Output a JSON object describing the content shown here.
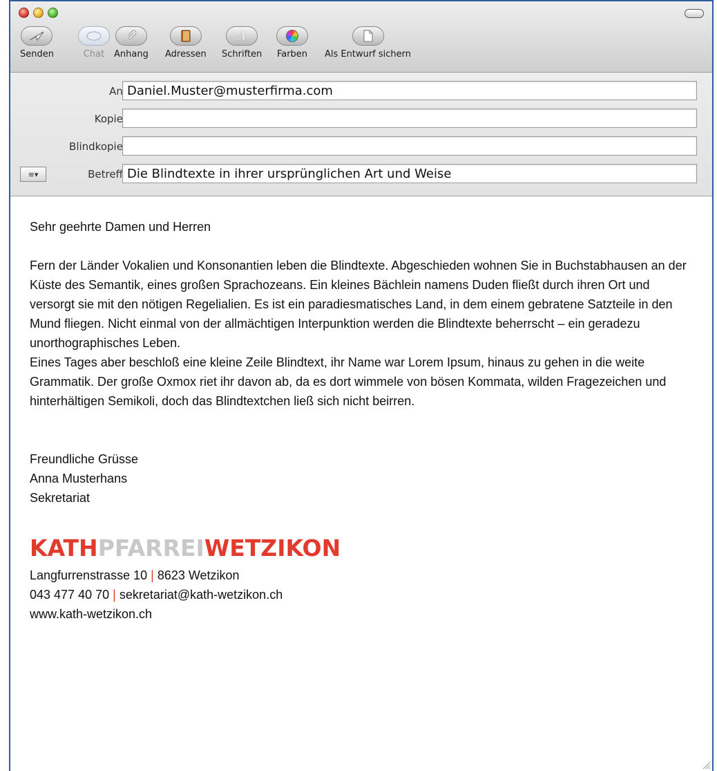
{
  "toolbar": {
    "send_label": "Senden",
    "chat_label": "Chat",
    "attach_label": "Anhang",
    "addresses_label": "Adressen",
    "fonts_label": "Schriften",
    "colors_label": "Farben",
    "save_draft_label": "Als Entwurf sichern"
  },
  "header": {
    "to_label": "An:",
    "to_value": "Daniel.Muster@musterfirma.com",
    "cc_label": "Kopie:",
    "cc_value": "",
    "bcc_label": "Blindkopie:",
    "bcc_value": "",
    "subject_label": "Betreff:",
    "subject_value": "Die Blindtexte in ihrer ursprünglichen Art und Weise"
  },
  "message": {
    "greeting": "Sehr geehrte Damen und Herren",
    "paragraph1": "Fern der Länder Vokalien und Konsonantien leben die Blindtexte. Abgeschieden wohnen Sie in Buchstabhausen an der Küste des Semantik, eines großen Sprachozeans. Ein kleines Bächlein namens Duden fließt durch ihren Ort und versorgt sie mit den nötigen Regelialien. Es ist ein paradiesmatisches Land, in dem einem gebratene Satzteile in den Mund fliegen. Nicht einmal von der allmächtigen Interpunktion werden die Blindtexte beherrscht – ein geradezu unorthographisches Leben.",
    "paragraph2": "Eines Tages aber beschloß eine kleine Zeile Blindtext, ihr Name war Lorem Ipsum, hinaus zu gehen in die weite Grammatik. Der große Oxmox riet ihr davon ab, da es dort wimmele von bösen Kommata, wilden Fragezeichen und hinterhältigen Semikoli, doch das Blindtextchen ließ sich nicht beirren.",
    "closing": "Freundliche Grüsse",
    "sender_name": "Anna Musterhans",
    "sender_role": "Sekretariat"
  },
  "signature": {
    "logo_part1": "KATH",
    "logo_part2": "PFARREI",
    "logo_part3": "WETZIKON",
    "address": "Langfurrenstrasse 10",
    "separator": "|",
    "city": "8623 Wetzikon",
    "phone": "043 477 40 70",
    "email": "sekretariat@kath-wetzikon.ch",
    "website": "www.kath-wetzikon.ch"
  },
  "colors": {
    "brand_red": "#e23a2c",
    "brand_grey": "#c8c8c8",
    "window_border": "#2f5d9c"
  },
  "icons": [
    "send-icon",
    "chat-icon",
    "attachment-icon",
    "address-book-icon",
    "fonts-icon",
    "colors-icon",
    "save-draft-icon",
    "format-menu-icon"
  ]
}
